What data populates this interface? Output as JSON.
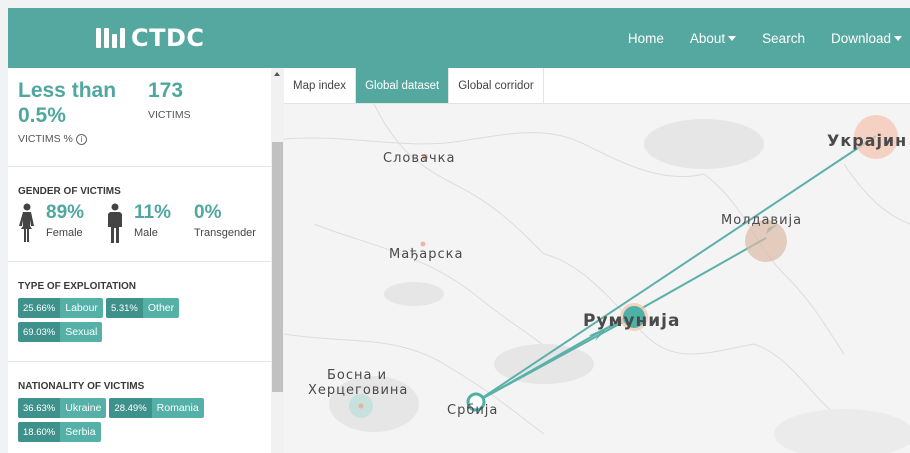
{
  "navbar": {
    "brand": "CTDC",
    "links": [
      {
        "label": "Home",
        "has_caret": false
      },
      {
        "label": "About",
        "has_caret": true
      },
      {
        "label": "Search",
        "has_caret": false
      },
      {
        "label": "Download",
        "has_caret": true
      }
    ]
  },
  "summary": {
    "percent_value_line1": "Less than",
    "percent_value_line2": "0.5%",
    "percent_label": "VICTIMS %",
    "info_icon": "info-icon",
    "victims_value": "173",
    "victims_label": "VICTIMS"
  },
  "gender": {
    "title": "GENDER OF VICTIMS",
    "items": [
      {
        "value": "89%",
        "label": "Female",
        "icon": "female-icon"
      },
      {
        "value": "11%",
        "label": "Male",
        "icon": "male-icon"
      },
      {
        "value": "0%",
        "label": "Transgender",
        "icon": ""
      }
    ]
  },
  "exploitation": {
    "title": "TYPE OF EXPLOITATION",
    "tags": [
      {
        "percent": "25.66%",
        "label": "Labour"
      },
      {
        "percent": "5.31%",
        "label": "Other"
      },
      {
        "percent": "69.03%",
        "label": "Sexual"
      }
    ]
  },
  "nationality": {
    "title": "NATIONALITY OF VICTIMS",
    "tags": [
      {
        "percent": "36.63%",
        "label": "Ukraine"
      },
      {
        "percent": "28.49%",
        "label": "Romania"
      },
      {
        "percent": "18.60%",
        "label": "Serbia"
      }
    ]
  },
  "tabs": [
    {
      "label": "Map index",
      "active": false
    },
    {
      "label": "Global dataset",
      "active": true
    },
    {
      "label": "Global corridor",
      "active": false
    }
  ],
  "map": {
    "labels": {
      "slovakia": "Словачка",
      "ukraine": "Украјин",
      "moldova": "Молдавија",
      "hungary": "Мађарска",
      "romania": "Румунија",
      "bosnia_1": "Босна и",
      "bosnia_2": "Херцеговина",
      "serbia": "Србија"
    },
    "colors": {
      "route": "#5bb1a9",
      "bubble_peach": "#f6c6b3",
      "bubble_tan": "#dcb9a6",
      "bubble_teal": "#4fb0a6",
      "bubble_light": "#bfe0dc"
    }
  }
}
